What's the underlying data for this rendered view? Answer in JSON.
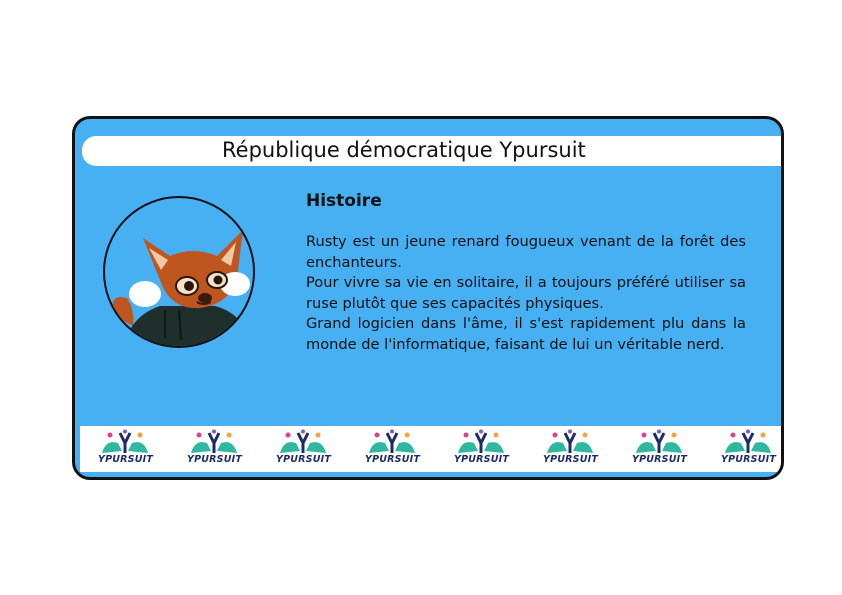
{
  "card": {
    "title": "République démocratique Ypursuit",
    "heading": "Histoire",
    "paragraphs": [
      "Rusty est un jeune renard fougueux venant de la forêt des enchanteurs.",
      "Pour vivre sa vie en solitaire, il a toujours préféré utiliser sa ruse plutôt que ses capacités physiques.",
      "Grand logicien dans l'âme, il s'est rapidement plu dans la monde de l'informatique, faisant de lui un véritable nerd."
    ]
  },
  "avatar": {
    "icon": "fox-avatar-icon"
  },
  "banner": {
    "logos": [
      "YPURSUIT",
      "YPURSUIT",
      "YPURSUIT",
      "YPURSUIT",
      "YPURSUIT",
      "YPURSUIT",
      "YPURSUIT",
      "YPURSUIT"
    ]
  },
  "colors": {
    "card_bg": "#46b0f3",
    "border": "#111111",
    "fox": "#c0561f",
    "hoodie": "#1f2f2c",
    "logo_text": "#1c2c6b"
  }
}
